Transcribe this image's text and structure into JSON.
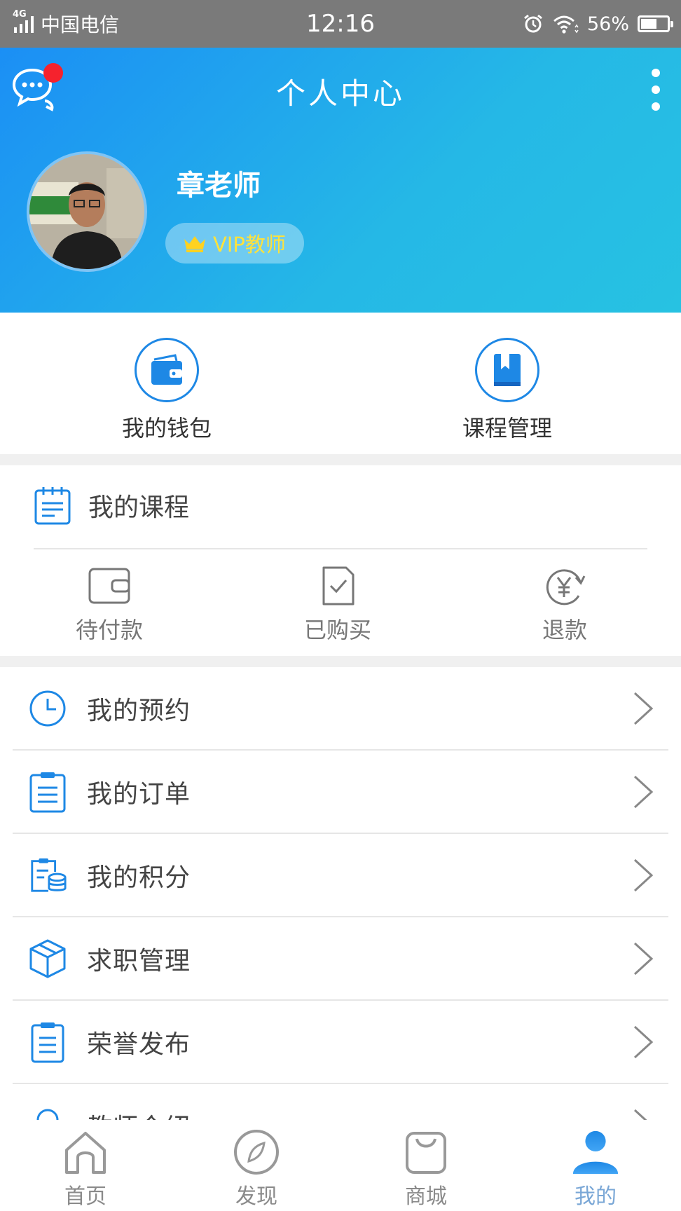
{
  "status_bar": {
    "network": "4G",
    "carrier": "中国电信",
    "time": "12:16",
    "battery_text": "56%",
    "battery_level": 0.56
  },
  "header": {
    "title": "个人中心",
    "user_name": "章老师",
    "vip_label": "VIP教师",
    "has_unread_message": true
  },
  "quick_actions": [
    {
      "label": "我的钱包",
      "icon": "wallet-icon"
    },
    {
      "label": "课程管理",
      "icon": "book-icon"
    }
  ],
  "my_courses": {
    "title": "我的课程",
    "options": [
      {
        "label": "待付款",
        "icon": "wallet-outline-icon"
      },
      {
        "label": "已购买",
        "icon": "check-doc-icon"
      },
      {
        "label": "退款",
        "icon": "refund-yen-icon"
      }
    ]
  },
  "menu": [
    {
      "label": "我的预约",
      "icon": "clock-icon"
    },
    {
      "label": "我的订单",
      "icon": "clipboard-list-icon"
    },
    {
      "label": "我的积分",
      "icon": "coins-icon"
    },
    {
      "label": "求职管理",
      "icon": "cube-icon"
    },
    {
      "label": "荣誉发布",
      "icon": "clipboard-icon"
    },
    {
      "label": "教师介绍",
      "icon": "person-icon"
    }
  ],
  "tabbar": [
    {
      "label": "首页",
      "icon": "home-icon",
      "active": false
    },
    {
      "label": "发现",
      "icon": "compass-icon",
      "active": false
    },
    {
      "label": "商城",
      "icon": "bag-icon",
      "active": false
    },
    {
      "label": "我的",
      "icon": "user-icon",
      "active": true
    }
  ],
  "colors": {
    "accent": "#1e88e5",
    "header_gradient_start": "#1b8ff5",
    "header_gradient_end": "#27c2e2",
    "vip_text": "#ffe23a",
    "badge": "#f5222d",
    "status_bar": "#7a7a7a"
  }
}
